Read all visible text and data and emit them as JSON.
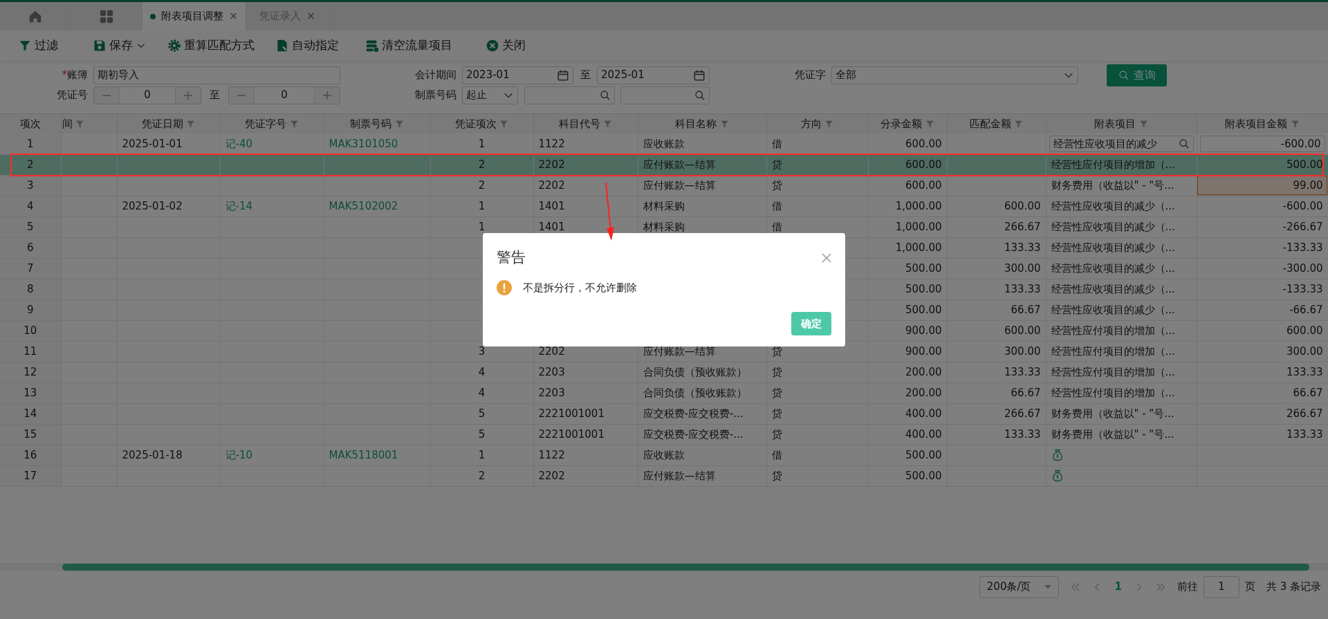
{
  "tabs": [
    {
      "kind": "home",
      "selected": false
    },
    {
      "kind": "apps",
      "selected": false
    },
    {
      "kind": "text",
      "label": "附表项目调整",
      "close": "×",
      "selected": true
    },
    {
      "kind": "text",
      "label": "凭证录入",
      "close": "×",
      "selected": false
    }
  ],
  "toolbar": [
    {
      "label": "过滤"
    },
    {
      "label": "保存",
      "dropdown": true
    },
    {
      "label": "重算匹配方式"
    },
    {
      "label": "自动指定"
    },
    {
      "label": "清空流量项目"
    },
    {
      "label": "关闭"
    }
  ],
  "filters": {
    "ledger": {
      "label": "账簿",
      "required_mark": "*",
      "value": "期初导入"
    },
    "period": {
      "label": "会计期间",
      "from": "2023-01",
      "separator": "至",
      "to": "2025-01"
    },
    "voucher_type": {
      "label": "凭证字",
      "value": "全部"
    },
    "query_button": "查询",
    "voucher_no": {
      "label": "凭证号",
      "from": "0",
      "separator": "至",
      "to": "0"
    },
    "ticket_no": {
      "label": "制票号码",
      "mode": "起止"
    }
  },
  "table": {
    "columns": [
      {
        "label": "项次",
        "filter": false
      },
      {
        "label": "间",
        "filter": true
      },
      {
        "label": "凭证日期",
        "filter": true
      },
      {
        "label": "凭证字号",
        "filter": true
      },
      {
        "label": "制票号码",
        "filter": true
      },
      {
        "label": "凭证项次",
        "filter": true
      },
      {
        "label": "科目代号",
        "filter": true
      },
      {
        "label": "科目名称",
        "filter": true
      },
      {
        "label": "方向",
        "filter": true
      },
      {
        "label": "分录金额",
        "filter": true
      },
      {
        "label": "匹配金额",
        "filter": true
      },
      {
        "label": "附表项目",
        "filter": true
      },
      {
        "label": "附表项目金额",
        "filter": true
      }
    ],
    "rows": [
      {
        "selected": false,
        "highlighted": false,
        "no": "1",
        "date": "2025-01-01",
        "voucher": "记-40",
        "ticket": "MAK3101050",
        "line": "1",
        "code": "1122",
        "account": "应收账款",
        "dir": "借",
        "amount": "600.00",
        "item": {
          "kind": "search",
          "text": "经营性应收项目的减少"
        },
        "item_amount": {
          "kind": "input",
          "text": "-600.00"
        }
      },
      {
        "selected": true,
        "highlighted": true,
        "no": "2",
        "line": "2",
        "code": "2202",
        "account": "应付账款—结算",
        "dir": "贷",
        "amount": "600.00",
        "item": {
          "kind": "text",
          "text": "经营性应付项目的增加（..."
        },
        "item_amount": {
          "kind": "text",
          "text": "500.00"
        }
      },
      {
        "selected": false,
        "highlighted": false,
        "no": "3",
        "line": "2",
        "code": "2202",
        "account": "应付账款—结算",
        "dir": "贷",
        "amount": "600.00",
        "item": {
          "kind": "text",
          "text": "财务费用（收益以\" - \"号..."
        },
        "item_amount": {
          "kind": "edited",
          "text": "99.00"
        }
      },
      {
        "selected": false,
        "highlighted": false,
        "no": "4",
        "date": "2025-01-02",
        "voucher": "记-14",
        "ticket": "MAK5102002",
        "line": "1",
        "code": "1401",
        "account": "材料采购",
        "dir": "借",
        "amount": "1,000.00",
        "matched": "600.00",
        "item": {
          "kind": "text",
          "text": "经营性应收项目的减少（..."
        },
        "item_amount": {
          "kind": "text",
          "text": "-600.00"
        }
      },
      {
        "selected": false,
        "highlighted": false,
        "no": "5",
        "line": "1",
        "code": "1401",
        "account": "材料采购",
        "dir": "借",
        "amount": "1,000.00",
        "matched": "266.67",
        "item": {
          "kind": "text",
          "text": "经营性应收项目的减少（..."
        },
        "item_amount": {
          "kind": "text",
          "text": "-266.67"
        }
      },
      {
        "selected": false,
        "highlighted": false,
        "no": "6",
        "amount": "1,000.00",
        "matched": "133.33",
        "item": {
          "kind": "text",
          "text": "经营性应收项目的减少（..."
        },
        "item_amount": {
          "kind": "text",
          "text": "-133.33"
        }
      },
      {
        "selected": false,
        "highlighted": false,
        "no": "7",
        "amount": "500.00",
        "matched": "300.00",
        "item": {
          "kind": "text",
          "text": "经营性应收项目的减少（..."
        },
        "item_amount": {
          "kind": "text",
          "text": "-300.00"
        }
      },
      {
        "selected": false,
        "highlighted": false,
        "no": "8",
        "amount": "500.00",
        "matched": "133.33",
        "item": {
          "kind": "text",
          "text": "经营性应收项目的减少（..."
        },
        "item_amount": {
          "kind": "text",
          "text": "-133.33"
        }
      },
      {
        "selected": false,
        "highlighted": false,
        "no": "9",
        "amount": "500.00",
        "matched": "66.67",
        "item": {
          "kind": "text",
          "text": "经营性应收项目的减少（..."
        },
        "item_amount": {
          "kind": "text",
          "text": "-66.67"
        }
      },
      {
        "selected": false,
        "highlighted": false,
        "no": "10",
        "amount": "900.00",
        "matched": "600.00",
        "item": {
          "kind": "text",
          "text": "经营性应付项目的增加（..."
        },
        "item_amount": {
          "kind": "text",
          "text": "600.00"
        }
      },
      {
        "selected": false,
        "highlighted": false,
        "no": "11",
        "line": "3",
        "code": "2202",
        "account": "应付账款—结算",
        "dir": "贷",
        "amount": "900.00",
        "matched": "300.00",
        "item": {
          "kind": "text",
          "text": "经营性应付项目的增加（..."
        },
        "item_amount": {
          "kind": "text",
          "text": "300.00"
        }
      },
      {
        "selected": false,
        "highlighted": false,
        "no": "12",
        "line": "4",
        "code": "2203",
        "account": "合同负债（预收账款）",
        "dir": "贷",
        "amount": "200.00",
        "matched": "133.33",
        "item": {
          "kind": "text",
          "text": "经营性应付项目的增加（..."
        },
        "item_amount": {
          "kind": "text",
          "text": "133.33"
        }
      },
      {
        "selected": false,
        "highlighted": false,
        "no": "13",
        "line": "4",
        "code": "2203",
        "account": "合同负债（预收账款）",
        "dir": "贷",
        "amount": "200.00",
        "matched": "66.67",
        "item": {
          "kind": "text",
          "text": "经营性应付项目的增加（..."
        },
        "item_amount": {
          "kind": "text",
          "text": "66.67"
        }
      },
      {
        "selected": false,
        "highlighted": false,
        "no": "14",
        "line": "5",
        "code": "2221001001",
        "account": "应交税费-应交税费-...",
        "dir": "贷",
        "amount": "400.00",
        "matched": "266.67",
        "item": {
          "kind": "text",
          "text": "财务费用（收益以\" - \"号..."
        },
        "item_amount": {
          "kind": "text",
          "text": "266.67"
        }
      },
      {
        "selected": false,
        "highlighted": false,
        "no": "15",
        "line": "5",
        "code": "2221001001",
        "account": "应交税费-应交税费-...",
        "dir": "贷",
        "amount": "400.00",
        "matched": "133.33",
        "item": {
          "kind": "text",
          "text": "财务费用（收益以\" - \"号..."
        },
        "item_amount": {
          "kind": "text",
          "text": "133.33"
        }
      },
      {
        "selected": false,
        "highlighted": false,
        "no": "16",
        "date": "2025-01-18",
        "voucher": "记-10",
        "ticket": "MAK5118001",
        "line": "1",
        "code": "1122",
        "account": "应收账款",
        "dir": "借",
        "amount": "500.00",
        "item": {
          "kind": "icon"
        }
      },
      {
        "selected": false,
        "highlighted": false,
        "no": "17",
        "line": "2",
        "code": "2202",
        "account": "应付账款—结算",
        "dir": "贷",
        "amount": "500.00",
        "item": {
          "kind": "icon"
        }
      }
    ]
  },
  "pagination": {
    "page_size": "200条/页",
    "current": "1",
    "goto_label": "前往",
    "goto_value": "1",
    "page_unit": "页",
    "total": "共 3 条记录"
  },
  "dialog": {
    "title": "警告",
    "message": "不是拆分行，不允许删除",
    "ok": "确定"
  }
}
